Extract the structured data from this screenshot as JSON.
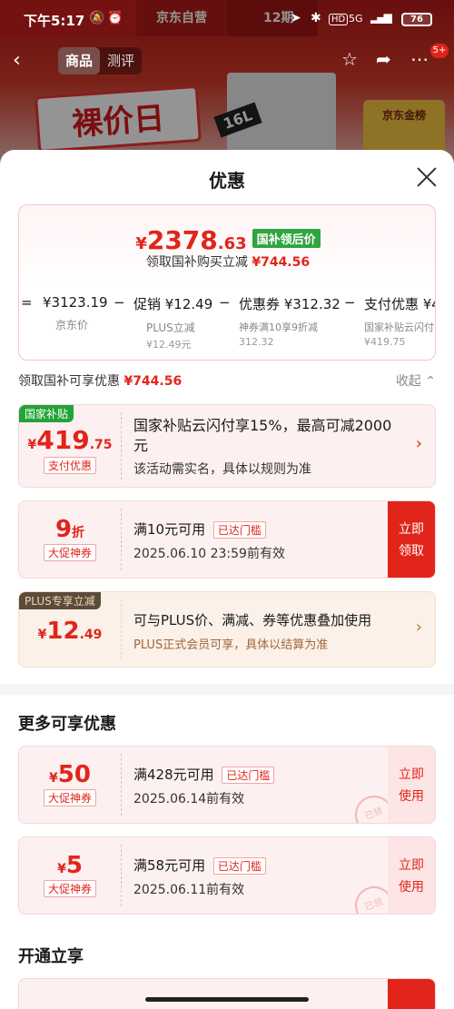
{
  "status": {
    "time": "下午5:17",
    "network": "5G",
    "battery": "76"
  },
  "background": {
    "banner_left": "京东自营",
    "banner_right": "12期",
    "big_sale": "裸价日",
    "prod_tag": "16L",
    "badge": "京东金榜"
  },
  "nav": {
    "tabs": [
      "商品",
      "测评"
    ],
    "badge": "5+"
  },
  "sheet": {
    "title": "优惠",
    "price": {
      "yen": "¥",
      "integer": "2378",
      "decimal": ".63",
      "tag": "国补领后价",
      "sub_text": "领取国补购买立减",
      "sub_amount": "¥744.56"
    },
    "breakdown": [
      {
        "value": "¥3123.19",
        "label": "京东价",
        "sub": ""
      },
      {
        "value": "促销 ¥12.49",
        "label": "PLUS立减",
        "sub": "¥12.49元"
      },
      {
        "value": "优惠券 ¥312.32",
        "label": "神券满10享9折减",
        "sub": "312.32"
      },
      {
        "value": "支付优惠 ¥4",
        "label": "国家补贴云闪付",
        "sub": "¥419.75"
      }
    ],
    "operators": [
      "=",
      "−",
      "−",
      "−"
    ],
    "section_row": {
      "text": "领取国补可享优惠",
      "amount": "¥744.56",
      "collapse": "收起 ⌃"
    },
    "coupons": [
      {
        "tag": "国家补贴",
        "yen": "¥",
        "num": "419",
        "dec": ".75",
        "chip": "支付优惠",
        "title": "国家补贴云闪付享15%，最高可减2000元",
        "desc": "该活动需实名，具体以规则为准",
        "arrow": "›"
      },
      {
        "num": "9",
        "unit": "折",
        "chip": "大促神券",
        "title": "满10元可用",
        "status": "已达门槛",
        "desc": "2025.06.10 23:59前有效",
        "btn1": "立即",
        "btn2": "领取"
      },
      {
        "tag": "PLUS专享立减",
        "yen": "¥",
        "num": "12",
        "dec": ".49",
        "title": "可与PLUS价、满减、券等优惠叠加使用",
        "desc": "PLUS正式会员可享，具体以结算为准",
        "arrow": "›"
      }
    ],
    "more_title": "更多可享优惠",
    "more_coupons": [
      {
        "yen": "¥",
        "num": "50",
        "chip": "大促神券",
        "title": "满428元可用",
        "status": "已达门槛",
        "desc": "2025.06.14前有效",
        "btn1": "立即",
        "btn2": "使用",
        "stamp": "已领"
      },
      {
        "yen": "¥",
        "num": "5",
        "chip": "大促神券",
        "title": "满58元可用",
        "status": "已达门槛",
        "desc": "2025.06.11前有效",
        "btn1": "立即",
        "btn2": "使用",
        "stamp": "已领"
      }
    ],
    "open_title": "开通立享"
  }
}
